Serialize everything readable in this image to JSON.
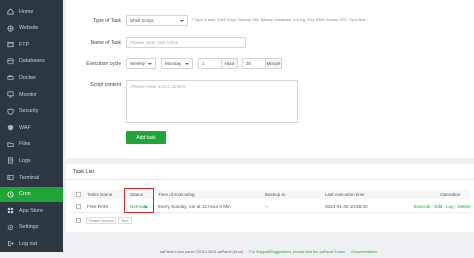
{
  "sidebar": {
    "items": [
      {
        "label": "Home",
        "icon": "home-icon"
      },
      {
        "label": "Website",
        "icon": "globe-icon"
      },
      {
        "label": "FTP",
        "icon": "ftp-icon"
      },
      {
        "label": "Databases",
        "icon": "database-icon"
      },
      {
        "label": "Docker",
        "icon": "docker-icon"
      },
      {
        "label": "Monitor",
        "icon": "monitor-icon"
      },
      {
        "label": "Security",
        "icon": "shield-icon"
      },
      {
        "label": "WAF",
        "icon": "waf-icon"
      },
      {
        "label": "Files",
        "icon": "folder-icon"
      },
      {
        "label": "Logs",
        "icon": "logs-icon"
      },
      {
        "label": "Terminal",
        "icon": "terminal-icon"
      },
      {
        "label": "Cron",
        "icon": "clock-icon"
      },
      {
        "label": "App Store",
        "icon": "app-store-icon"
      },
      {
        "label": "Settings",
        "icon": "gear-icon"
      },
      {
        "label": "Log out",
        "icon": "logout-icon"
      }
    ],
    "active_index": 11
  },
  "form": {
    "type_label": "Type of Task",
    "type_value": "Shell Script",
    "type_note": "* Type of task: Shell Script, Backup Site, Backup Database, Cut log, Free RAM, Access URL, Sync time",
    "name_label": "Name of Task",
    "name_placeholder": "Please enter task name",
    "cycle_label": "Execution cycle",
    "cycle_value": "Weekly",
    "day_value": "Monday",
    "hour_value": "1",
    "hour_unit": "Hour",
    "minute_value": "30",
    "minute_unit": "Minute",
    "script_label": "Script content",
    "script_placeholder": "Please enter script content",
    "add_button": "Add task"
  },
  "task_list": {
    "title": "Task List",
    "columns": [
      "Tasks Name",
      "Status",
      "Time of Executing",
      "Backup to",
      "Last execution time",
      "Operation"
    ],
    "rows": [
      {
        "name": "Free RAM",
        "status": "Normal",
        "time": "Every Sunday, run at 12 Hour 0 Min",
        "backup": "--",
        "last": "2024-01-30 10:55:00",
        "operations": [
          "Execute",
          "Edit",
          "Log",
          "Delete"
        ],
        "separator": "|"
      }
    ],
    "batch_placeholder": "Please choose",
    "batch_button": "Run"
  },
  "footer": {
    "copyright": "aaPanel Linux panel ©2014-2024 aaPanel (bt.cn)",
    "support": "For Support|Suggestions, please visit the aaPanel Forum",
    "docs": "Documentation"
  },
  "colors": {
    "accent": "#20a53a",
    "sidebar_bg": "#2d3740",
    "highlight": "#e0222c"
  }
}
